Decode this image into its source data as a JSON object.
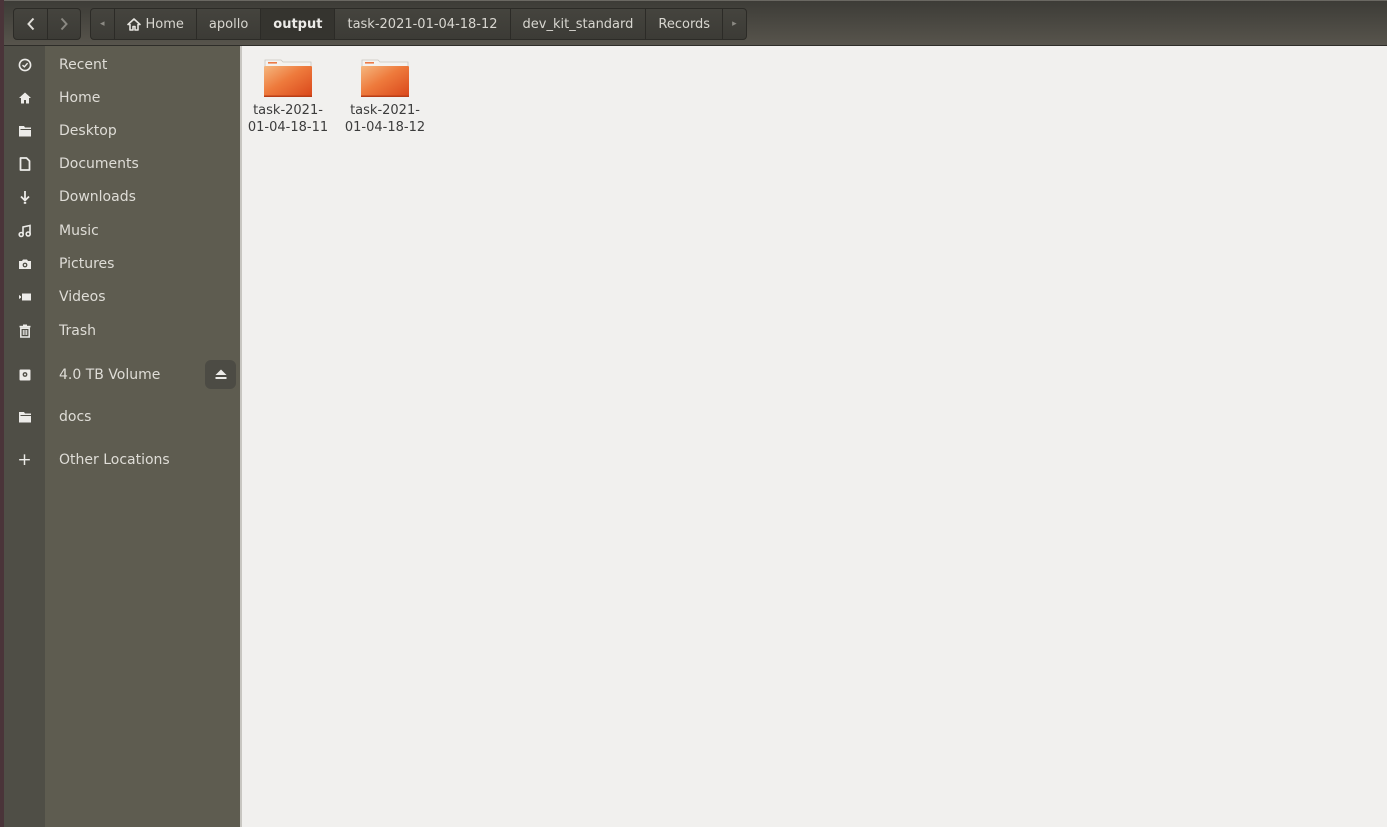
{
  "header": {
    "back_icon": "chevron-left",
    "forward_icon": "chevron-right",
    "breadcrumb_left_arrow": "◂",
    "breadcrumb_right_arrow": "▸",
    "breadcrumbs": [
      {
        "label": "Home",
        "icon": "home-icon",
        "active": false
      },
      {
        "label": "apollo",
        "active": false
      },
      {
        "label": "output",
        "active": true
      },
      {
        "label": "task-2021-01-04-18-12",
        "active": false
      },
      {
        "label": "dev_kit_standard",
        "active": false
      },
      {
        "label": "Records",
        "active": false
      }
    ]
  },
  "sidebar": {
    "items": [
      {
        "label": "Recent",
        "icon": "clock-icon"
      },
      {
        "label": "Home",
        "icon": "home-icon"
      },
      {
        "label": "Desktop",
        "icon": "folder-icon"
      },
      {
        "label": "Documents",
        "icon": "document-icon"
      },
      {
        "label": "Downloads",
        "icon": "download-icon"
      },
      {
        "label": "Music",
        "icon": "music-icon"
      },
      {
        "label": "Pictures",
        "icon": "camera-icon"
      },
      {
        "label": "Videos",
        "icon": "video-icon"
      },
      {
        "label": "Trash",
        "icon": "trash-icon"
      }
    ],
    "devices": [
      {
        "label": "4.0 TB Volume",
        "icon": "drive-icon",
        "eject": "⏏"
      }
    ],
    "bookmarks": [
      {
        "label": "docs",
        "icon": "folder-icon"
      }
    ],
    "other": {
      "label": "Other Locations",
      "icon": "plus-icon",
      "glyph": "+"
    }
  },
  "content": {
    "files": [
      {
        "name_line1": "task-2021-",
        "name_line2": "01-04-18-11",
        "type": "folder"
      },
      {
        "name_line1": "task-2021-",
        "name_line2": "01-04-18-12",
        "type": "folder"
      }
    ]
  },
  "colors": {
    "folder_orange": "#e95420",
    "sidebar_bg": "#5e5c50",
    "content_bg": "#f1f0ee"
  }
}
